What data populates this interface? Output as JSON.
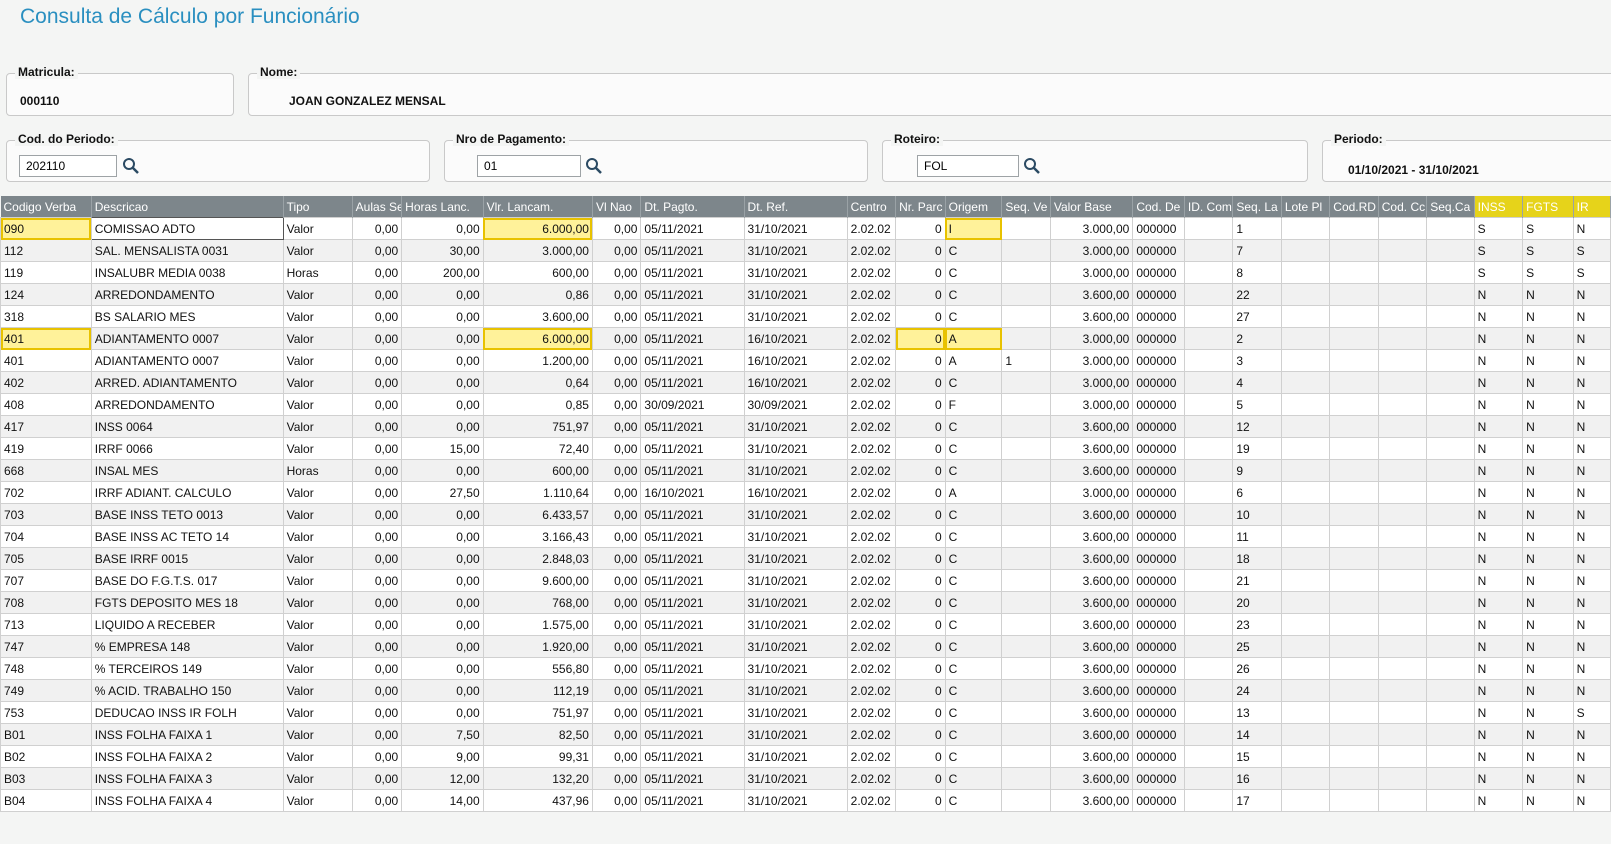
{
  "page": {
    "title": "Consulta de Cálculo por Funcionário"
  },
  "matricula": {
    "label": "Matricula:",
    "value": "000110"
  },
  "nome": {
    "label": "Nome:",
    "value": "JOAN GONZALEZ  MENSAL"
  },
  "cod_periodo": {
    "label": "Cod. do Periodo:",
    "value": "202110"
  },
  "nro_pagamento": {
    "label": "Nro de Pagamento:",
    "value": "01"
  },
  "roteiro": {
    "label": "Roteiro:",
    "value": "FOL"
  },
  "periodo": {
    "label": "Periodo:",
    "value": "01/10/2021 - 31/10/2021"
  },
  "table": {
    "columns": [
      "Codigo Verba",
      "Descricao",
      "Tipo",
      "Aulas Sem",
      "Horas Lanc.",
      "Vlr. Lancam.",
      "Vl Nao",
      "Dt. Pagto.",
      "Dt. Ref.",
      "Centro",
      "Nr. Parc",
      "Origem",
      "Seq. Ve",
      "Valor Base",
      "Cod. De",
      "ID. Com",
      "Seq. La",
      "Lote Pl",
      "Cod.RD",
      "Cod. Cc",
      "Seq.Ca",
      "INSS",
      "FGTS",
      "IR"
    ],
    "rows": [
      [
        "090",
        "COMISSAO ADTO",
        "Valor",
        "0,00",
        "0,00",
        "6.000,00",
        "0,00",
        "05/11/2021",
        "31/10/2021",
        "2.02.02",
        "0",
        "I",
        "",
        "3.000,00",
        "000000",
        "",
        "1",
        "",
        "",
        "",
        "",
        "S",
        "S",
        "N"
      ],
      [
        "112",
        "SAL. MENSALISTA 0031",
        "Valor",
        "0,00",
        "30,00",
        "3.000,00",
        "0,00",
        "05/11/2021",
        "31/10/2021",
        "2.02.02",
        "0",
        "C",
        "",
        "3.000,00",
        "000000",
        "",
        "7",
        "",
        "",
        "",
        "",
        "S",
        "S",
        "S"
      ],
      [
        "119",
        "INSALUBR MEDIA 0038",
        "Horas",
        "0,00",
        "200,00",
        "600,00",
        "0,00",
        "05/11/2021",
        "31/10/2021",
        "2.02.02",
        "0",
        "C",
        "",
        "3.000,00",
        "000000",
        "",
        "8",
        "",
        "",
        "",
        "",
        "S",
        "S",
        "S"
      ],
      [
        "124",
        "ARREDONDAMENTO",
        "Valor",
        "0,00",
        "0,00",
        "0,86",
        "0,00",
        "05/11/2021",
        "31/10/2021",
        "2.02.02",
        "0",
        "C",
        "",
        "3.600,00",
        "000000",
        "",
        "22",
        "",
        "",
        "",
        "",
        "N",
        "N",
        "N"
      ],
      [
        "318",
        "BS SALARIO MES",
        "Valor",
        "0,00",
        "0,00",
        "3.600,00",
        "0,00",
        "05/11/2021",
        "31/10/2021",
        "2.02.02",
        "0",
        "C",
        "",
        "3.600,00",
        "000000",
        "",
        "27",
        "",
        "",
        "",
        "",
        "N",
        "N",
        "N"
      ],
      [
        "401",
        "ADIANTAMENTO 0007",
        "Valor",
        "0,00",
        "0,00",
        "6.000,00",
        "0,00",
        "05/11/2021",
        "16/10/2021",
        "2.02.02",
        "0",
        "A",
        "",
        "3.000,00",
        "000000",
        "",
        "2",
        "",
        "",
        "",
        "",
        "N",
        "N",
        "N"
      ],
      [
        "401",
        "ADIANTAMENTO 0007",
        "Valor",
        "0,00",
        "0,00",
        "1.200,00",
        "0,00",
        "05/11/2021",
        "16/10/2021",
        "2.02.02",
        "0",
        "A",
        "1",
        "3.000,00",
        "000000",
        "",
        "3",
        "",
        "",
        "",
        "",
        "N",
        "N",
        "N"
      ],
      [
        "402",
        "ARRED. ADIANTAMENTO",
        "Valor",
        "0,00",
        "0,00",
        "0,64",
        "0,00",
        "05/11/2021",
        "16/10/2021",
        "2.02.02",
        "0",
        "C",
        "",
        "3.000,00",
        "000000",
        "",
        "4",
        "",
        "",
        "",
        "",
        "N",
        "N",
        "N"
      ],
      [
        "408",
        "ARREDONDAMENTO",
        "Valor",
        "0,00",
        "0,00",
        "0,85",
        "0,00",
        "30/09/2021",
        "30/09/2021",
        "2.02.02",
        "0",
        "F",
        "",
        "3.000,00",
        "000000",
        "",
        "5",
        "",
        "",
        "",
        "",
        "N",
        "N",
        "N"
      ],
      [
        "417",
        "INSS 0064",
        "Valor",
        "0,00",
        "0,00",
        "751,97",
        "0,00",
        "05/11/2021",
        "31/10/2021",
        "2.02.02",
        "0",
        "C",
        "",
        "3.600,00",
        "000000",
        "",
        "12",
        "",
        "",
        "",
        "",
        "N",
        "N",
        "N"
      ],
      [
        "419",
        "IRRF 0066",
        "Valor",
        "0,00",
        "15,00",
        "72,40",
        "0,00",
        "05/11/2021",
        "31/10/2021",
        "2.02.02",
        "0",
        "C",
        "",
        "3.600,00",
        "000000",
        "",
        "19",
        "",
        "",
        "",
        "",
        "N",
        "N",
        "N"
      ],
      [
        "668",
        "INSAL MES",
        "Horas",
        "0,00",
        "0,00",
        "600,00",
        "0,00",
        "05/11/2021",
        "31/10/2021",
        "2.02.02",
        "0",
        "C",
        "",
        "3.600,00",
        "000000",
        "",
        "9",
        "",
        "",
        "",
        "",
        "N",
        "N",
        "N"
      ],
      [
        "702",
        "IRRF ADIANT. CALCULO",
        "Valor",
        "0,00",
        "27,50",
        "1.110,64",
        "0,00",
        "16/10/2021",
        "16/10/2021",
        "2.02.02",
        "0",
        "A",
        "",
        "3.000,00",
        "000000",
        "",
        "6",
        "",
        "",
        "",
        "",
        "N",
        "N",
        "N"
      ],
      [
        "703",
        "BASE INSS TETO 0013",
        "Valor",
        "0,00",
        "0,00",
        "6.433,57",
        "0,00",
        "05/11/2021",
        "31/10/2021",
        "2.02.02",
        "0",
        "C",
        "",
        "3.600,00",
        "000000",
        "",
        "10",
        "",
        "",
        "",
        "",
        "N",
        "N",
        "N"
      ],
      [
        "704",
        "BASE INSS AC TETO 14",
        "Valor",
        "0,00",
        "0,00",
        "3.166,43",
        "0,00",
        "05/11/2021",
        "31/10/2021",
        "2.02.02",
        "0",
        "C",
        "",
        "3.600,00",
        "000000",
        "",
        "11",
        "",
        "",
        "",
        "",
        "N",
        "N",
        "N"
      ],
      [
        "705",
        "BASE IRRF 0015",
        "Valor",
        "0,00",
        "0,00",
        "2.848,03",
        "0,00",
        "05/11/2021",
        "31/10/2021",
        "2.02.02",
        "0",
        "C",
        "",
        "3.600,00",
        "000000",
        "",
        "18",
        "",
        "",
        "",
        "",
        "N",
        "N",
        "N"
      ],
      [
        "707",
        "BASE DO F.G.T.S. 017",
        "Valor",
        "0,00",
        "0,00",
        "9.600,00",
        "0,00",
        "05/11/2021",
        "31/10/2021",
        "2.02.02",
        "0",
        "C",
        "",
        "3.600,00",
        "000000",
        "",
        "21",
        "",
        "",
        "",
        "",
        "N",
        "N",
        "N"
      ],
      [
        "708",
        "FGTS DEPOSITO MES 18",
        "Valor",
        "0,00",
        "0,00",
        "768,00",
        "0,00",
        "05/11/2021",
        "31/10/2021",
        "2.02.02",
        "0",
        "C",
        "",
        "3.600,00",
        "000000",
        "",
        "20",
        "",
        "",
        "",
        "",
        "N",
        "N",
        "N"
      ],
      [
        "713",
        "LIQUIDO A RECEBER",
        "Valor",
        "0,00",
        "0,00",
        "1.575,00",
        "0,00",
        "05/11/2021",
        "31/10/2021",
        "2.02.02",
        "0",
        "C",
        "",
        "3.600,00",
        "000000",
        "",
        "23",
        "",
        "",
        "",
        "",
        "N",
        "N",
        "N"
      ],
      [
        "747",
        "% EMPRESA  148",
        "Valor",
        "0,00",
        "0,00",
        "1.920,00",
        "0,00",
        "05/11/2021",
        "31/10/2021",
        "2.02.02",
        "0",
        "C",
        "",
        "3.600,00",
        "000000",
        "",
        "25",
        "",
        "",
        "",
        "",
        "N",
        "N",
        "N"
      ],
      [
        "748",
        "% TERCEIROS 149",
        "Valor",
        "0,00",
        "0,00",
        "556,80",
        "0,00",
        "05/11/2021",
        "31/10/2021",
        "2.02.02",
        "0",
        "C",
        "",
        "3.600,00",
        "000000",
        "",
        "26",
        "",
        "",
        "",
        "",
        "N",
        "N",
        "N"
      ],
      [
        "749",
        "% ACID. TRABALHO 150",
        "Valor",
        "0,00",
        "0,00",
        "112,19",
        "0,00",
        "05/11/2021",
        "31/10/2021",
        "2.02.02",
        "0",
        "C",
        "",
        "3.600,00",
        "000000",
        "",
        "24",
        "",
        "",
        "",
        "",
        "N",
        "N",
        "N"
      ],
      [
        "753",
        "DEDUCAO INSS IR FOLH",
        "Valor",
        "0,00",
        "0,00",
        "751,97",
        "0,00",
        "05/11/2021",
        "31/10/2021",
        "2.02.02",
        "0",
        "C",
        "",
        "3.600,00",
        "000000",
        "",
        "13",
        "",
        "",
        "",
        "",
        "N",
        "N",
        "S"
      ],
      [
        "B01",
        "INSS FOLHA FAIXA 1",
        "Valor",
        "0,00",
        "7,50",
        "82,50",
        "0,00",
        "05/11/2021",
        "31/10/2021",
        "2.02.02",
        "0",
        "C",
        "",
        "3.600,00",
        "000000",
        "",
        "14",
        "",
        "",
        "",
        "",
        "N",
        "N",
        "N"
      ],
      [
        "B02",
        "INSS FOLHA FAIXA 2",
        "Valor",
        "0,00",
        "9,00",
        "99,31",
        "0,00",
        "05/11/2021",
        "31/10/2021",
        "2.02.02",
        "0",
        "C",
        "",
        "3.600,00",
        "000000",
        "",
        "15",
        "",
        "",
        "",
        "",
        "N",
        "N",
        "N"
      ],
      [
        "B03",
        "INSS FOLHA FAIXA 3",
        "Valor",
        "0,00",
        "12,00",
        "132,20",
        "0,00",
        "05/11/2021",
        "31/10/2021",
        "2.02.02",
        "0",
        "C",
        "",
        "3.600,00",
        "000000",
        "",
        "16",
        "",
        "",
        "",
        "",
        "N",
        "N",
        "N"
      ],
      [
        "B04",
        "INSS FOLHA FAIXA 4",
        "Valor",
        "0,00",
        "14,00",
        "437,96",
        "0,00",
        "05/11/2021",
        "31/10/2021",
        "2.02.02",
        "0",
        "C",
        "",
        "3.600,00",
        "000000",
        "",
        "17",
        "",
        "",
        "",
        "",
        "N",
        "N",
        "N"
      ]
    ]
  }
}
